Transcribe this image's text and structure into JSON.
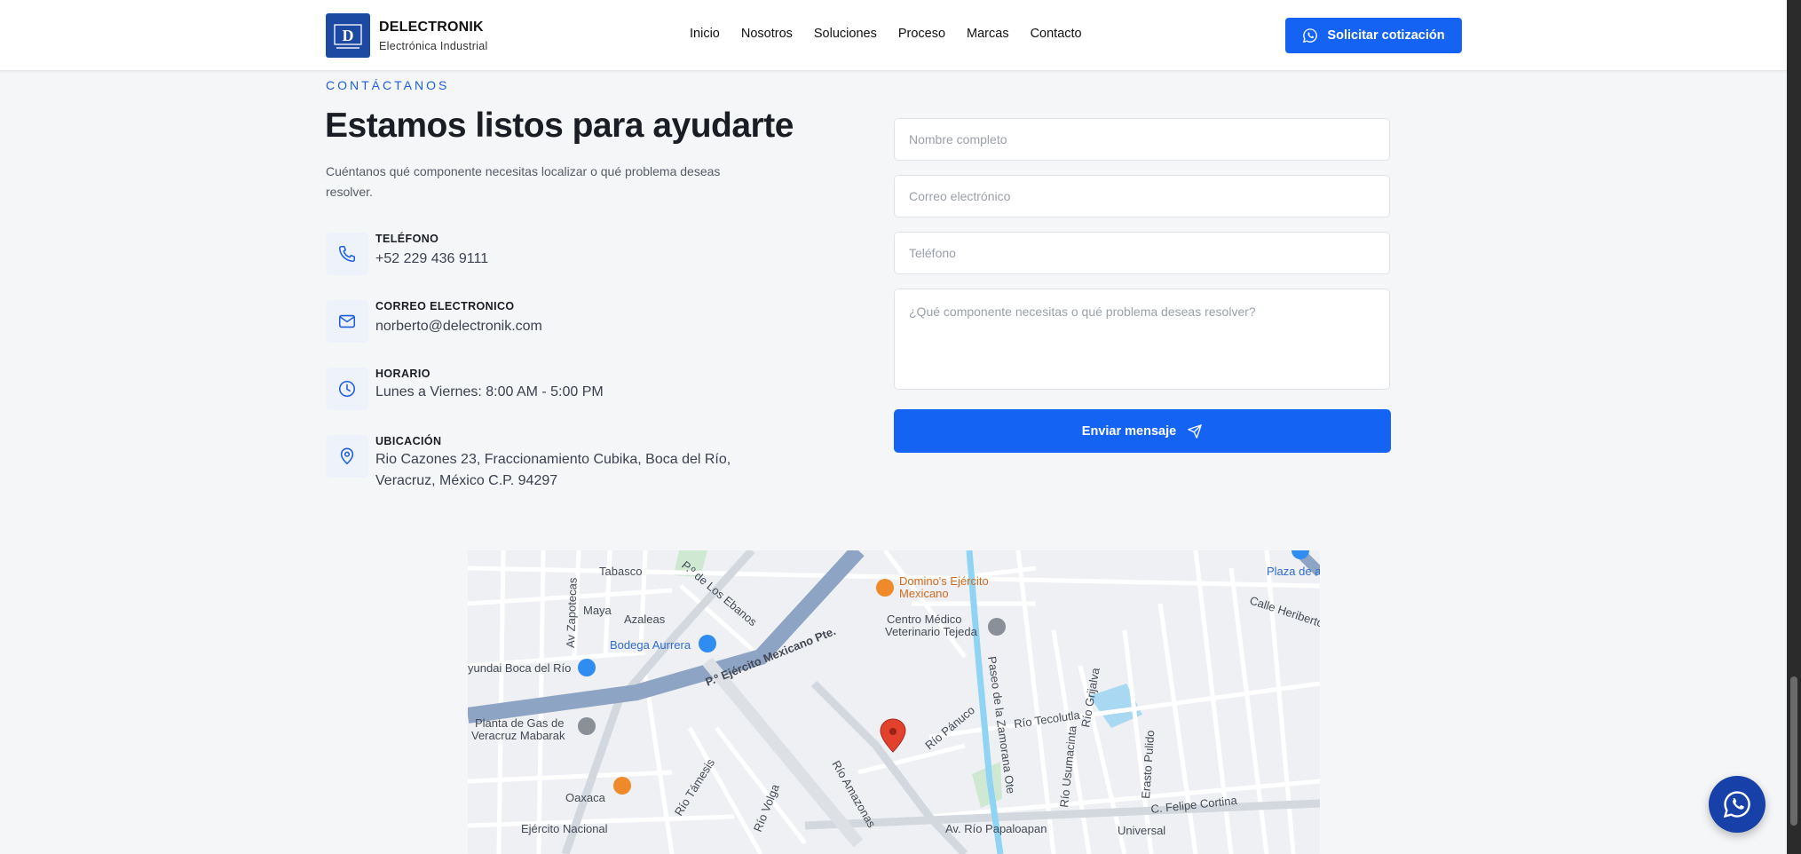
{
  "header": {
    "brand_name": "DELECTRONIK",
    "brand_sub": "Electrónica Industrial",
    "nav": [
      "Inicio",
      "Nosotros",
      "Soluciones",
      "Proceso",
      "Marcas",
      "Contacto"
    ],
    "cta_label": "Solicitar cotización"
  },
  "contact": {
    "eyebrow": "CONTÁCTANOS",
    "title": "Estamos listos para ayudarte",
    "description": "Cuéntanos qué componente necesitas localizar o qué problema deseas resolver.",
    "items": [
      {
        "label": "TELÉFONO",
        "value": "+52 229 436 9111",
        "icon": "phone-icon"
      },
      {
        "label": "CORREO ELECTRONICO",
        "value": "norberto@delectronik.com",
        "icon": "mail-icon"
      },
      {
        "label": "HORARIO",
        "value": "Lunes a Viernes: 8:00 AM - 5:00 PM",
        "icon": "clock-icon"
      },
      {
        "label": "UBICACIÓN",
        "value_line1": "Rio Cazones 23, Fraccionamiento Cubika, Boca del Río,",
        "value_line2": "Veracruz, México C.P. 94297",
        "icon": "location-pin-icon"
      }
    ]
  },
  "form": {
    "name_placeholder": "Nombre completo",
    "email_placeholder": "Correo electrónico",
    "phone_placeholder": "Teléfono",
    "message_placeholder": "¿Qué componente necesitas o qué problema deseas resolver?",
    "submit_label": "Enviar mensaje"
  },
  "map": {
    "labels": {
      "dominos": "Domino's Ejército Mexicano",
      "dominos_1": "Domino's Ejército",
      "dominos_2": "Mexicano",
      "centro_1": "Centro Médico",
      "centro_2": "Veterinario Tejeda",
      "bodega": "Bodega Aurrera",
      "hyundai": "yundai Boca del Río",
      "gas_1": "Planta de Gas de",
      "gas_2": "Veracruz Mabarak",
      "oaxaca": "Oaxaca",
      "ejercito": "P.º Ejército Mexicano Pte.",
      "ejercito_nacional": "Ejército Nacional",
      "papaloapan": "Av. Río Papaloapan",
      "felipe": "C. Felipe Cortina",
      "maya": "Maya",
      "azaleas": "Azaleas",
      "tabasco": "Tabasco",
      "ebanos": "P.º de Los Ebanos",
      "zapotecas": "Av Zapotecas",
      "plaza": "Plaza de a",
      "heriberto": "Calle Heriberto",
      "tecolutla": "Río Tecolutla",
      "grijalva": "Río Grijalva",
      "usumacinta": "Río Usumacinta",
      "zamorana": "Paseo de la Zamorana Ote",
      "panuco": "Río Pánuco",
      "erasto": "Erasto Pulido",
      "universal": "Universal",
      "volga": "Río Volga",
      "amazonas": "Río Amazonas",
      "tamesis": "Río Támesis"
    },
    "accent_red": "#e2412e",
    "poi_orange": "#ef8a2a",
    "poi_blue": "#2f8cf0"
  },
  "colors": {
    "primary": "#1463f3",
    "logo_bg": "#1c4aa3",
    "whatsapp_float": "#1741a8",
    "eyebrow": "#1e5fe0"
  }
}
